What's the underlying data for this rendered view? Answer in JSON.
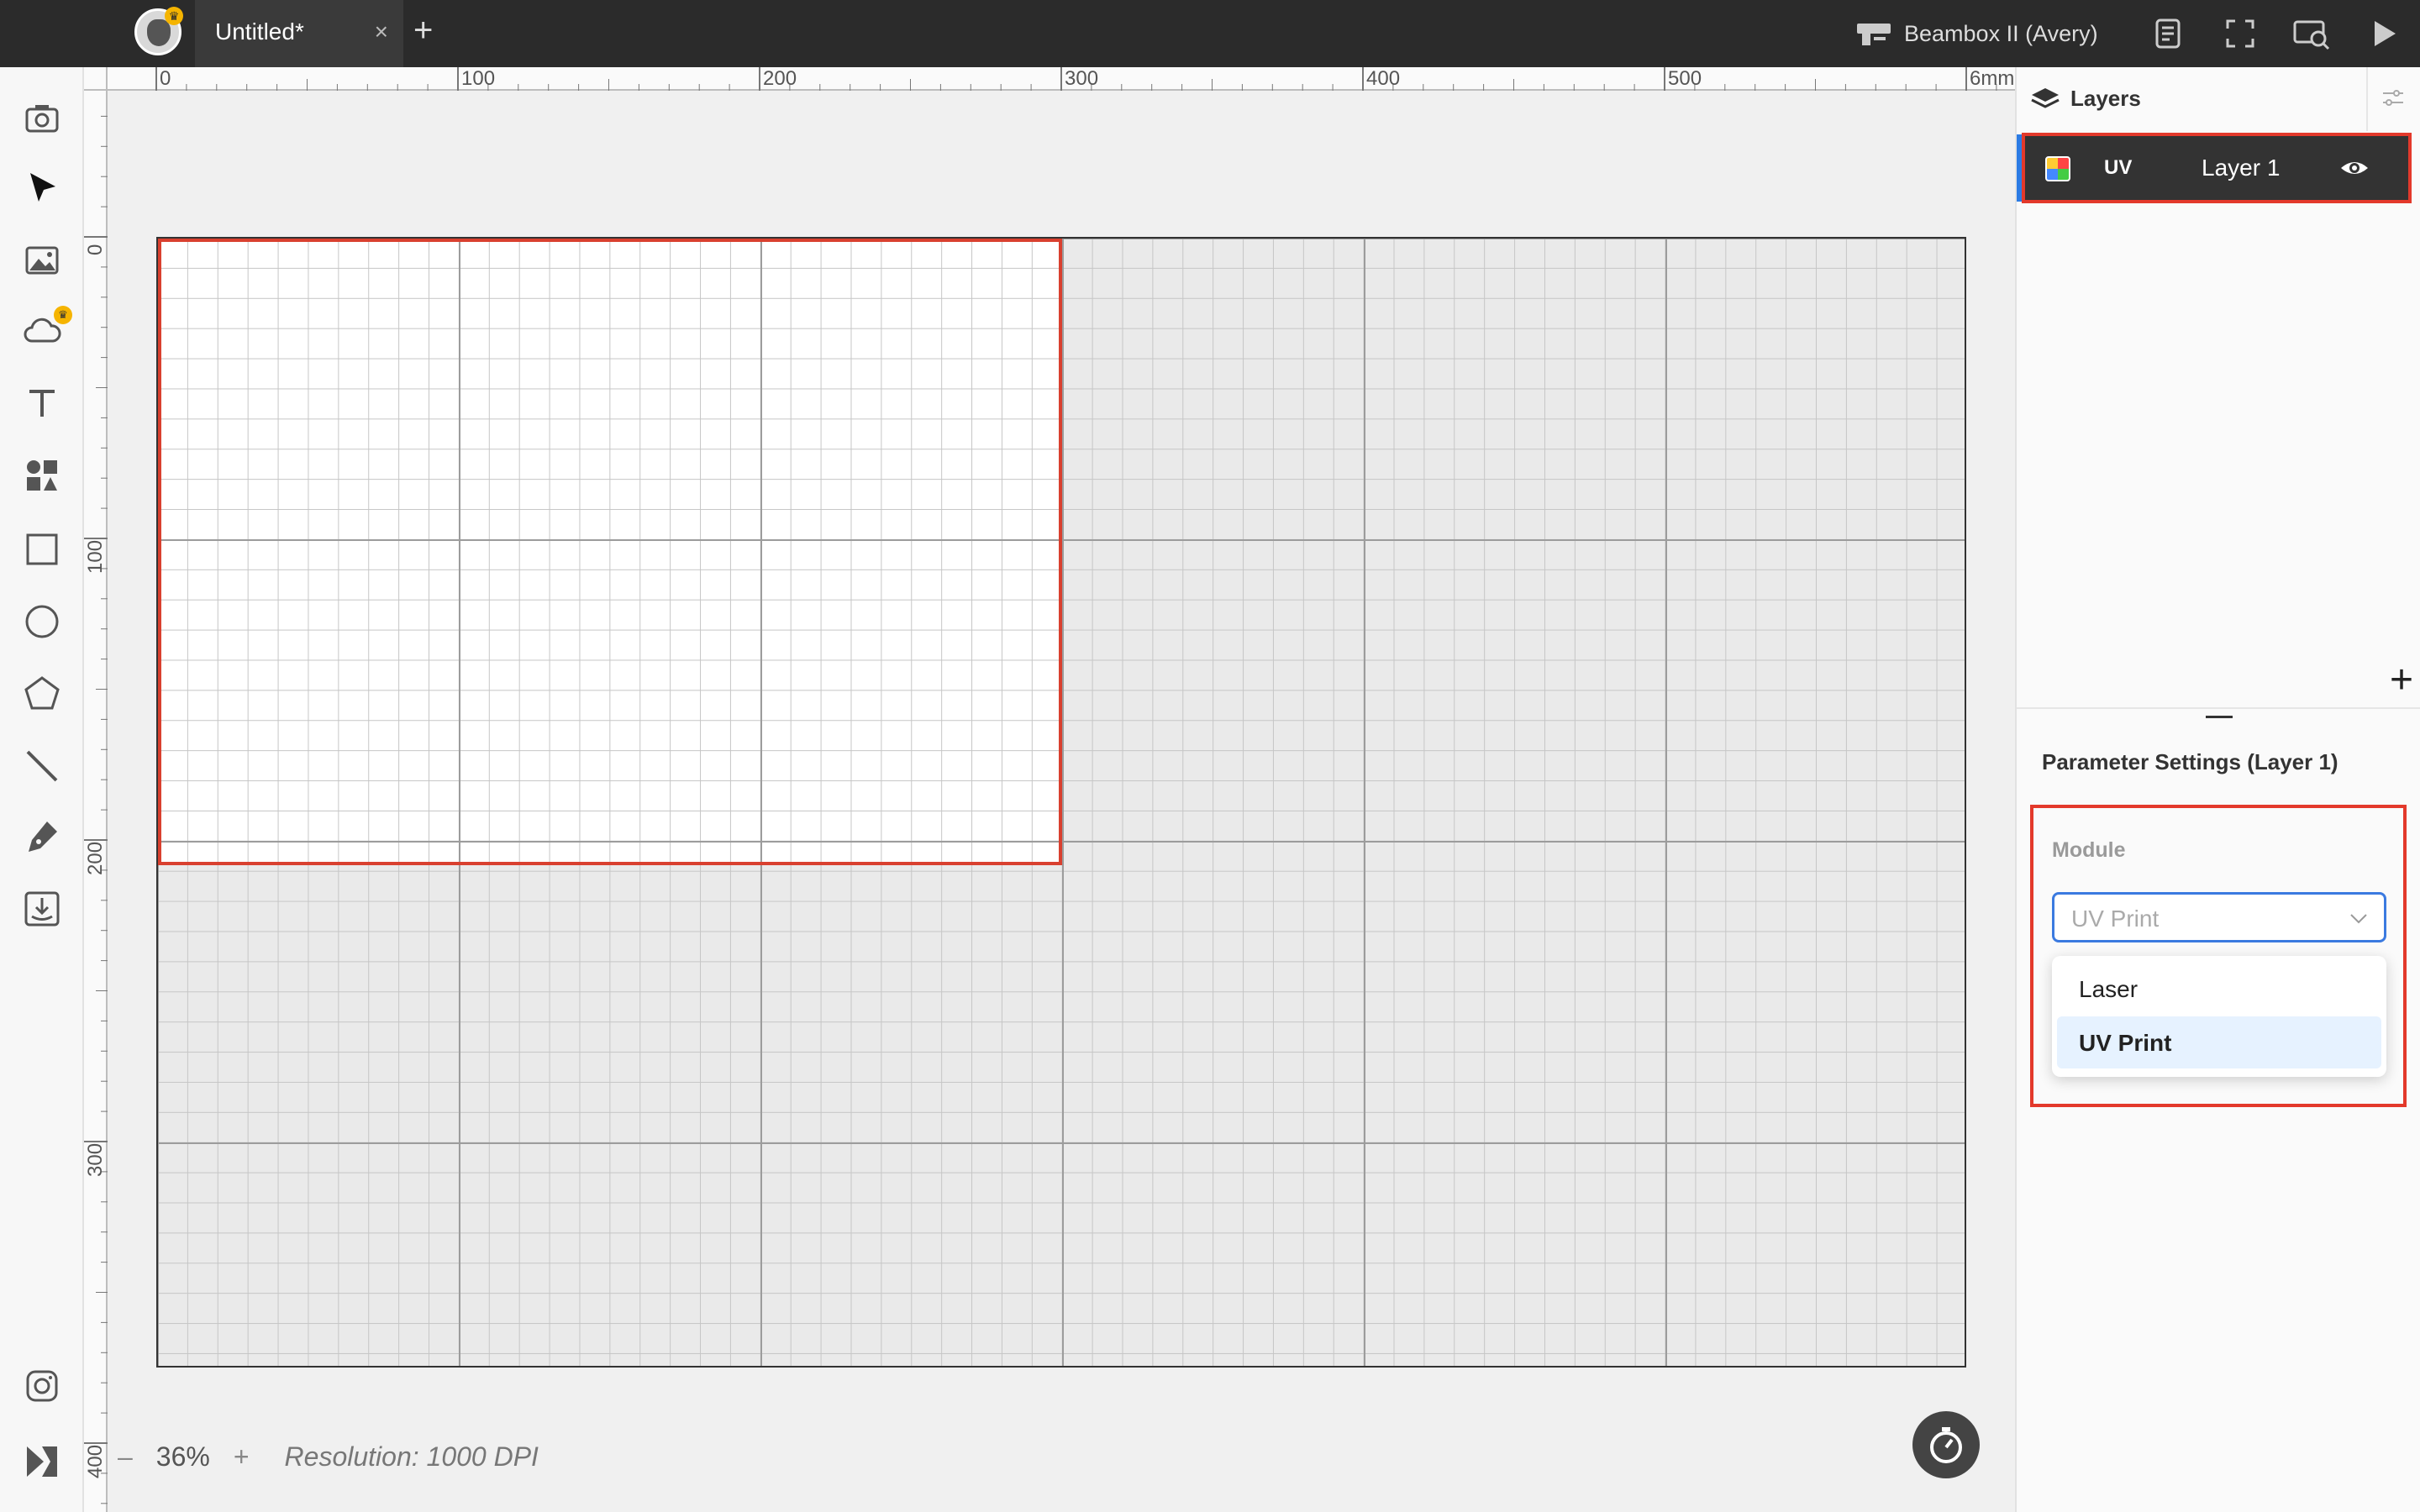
{
  "topbar": {
    "tab_title": "Untitled*",
    "tab_close": "×",
    "tab_add": "+",
    "machine_name": "Beambox II (Avery)",
    "icons": [
      "document-icon",
      "fullscreen-icon",
      "preview-icon",
      "play-icon"
    ]
  },
  "toolbar": {
    "tools": [
      "camera-icon",
      "select-arrow-icon",
      "image-icon",
      "cloud-icon",
      "text-icon",
      "shapes-icon",
      "rectangle-icon",
      "ellipse-icon",
      "polygon-icon",
      "line-icon",
      "pen-icon",
      "import-icon",
      "instagram-icon",
      "design-market-icon"
    ]
  },
  "ruler": {
    "top_labels": [
      "0",
      "100",
      "200",
      "300",
      "400",
      "500",
      "6mm"
    ],
    "left_labels": [
      "0",
      "100",
      "200",
      "300",
      "400"
    ]
  },
  "canvas": {
    "zoom_minus": "–",
    "zoom_value": "36%",
    "zoom_plus": "+",
    "resolution": "Resolution: 1000 DPI",
    "highlight_color": "#d9402f"
  },
  "layers": {
    "title": "Layers",
    "add": "+",
    "items": [
      {
        "module": "UV",
        "name": "Layer 1",
        "visible": true
      }
    ]
  },
  "params": {
    "title": "Parameter Settings (Layer 1)",
    "module_label": "Module",
    "module_value": "UV Print",
    "options": [
      "Laser",
      "UV Print"
    ],
    "selected_option": "UV Print"
  },
  "colors": {
    "accent": "#3b7ae0",
    "highlight": "#e3392b",
    "topbar": "#2b2b2b"
  }
}
